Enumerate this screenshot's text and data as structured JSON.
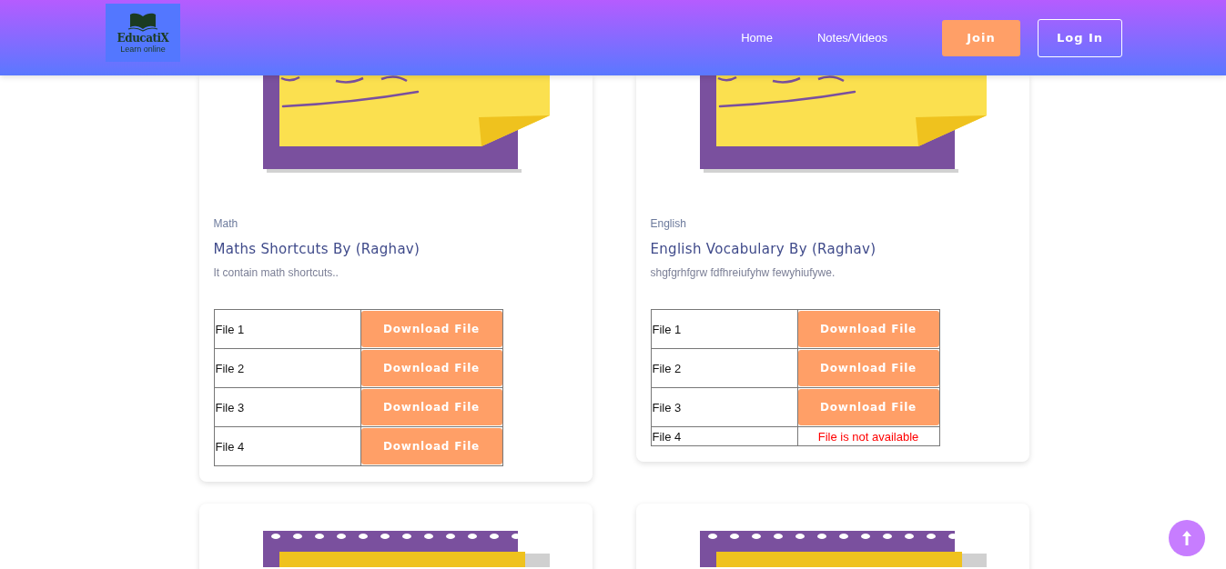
{
  "header": {
    "logo": {
      "name": "EducatiX",
      "tagline": "Learn online"
    },
    "nav": [
      {
        "label": "Home",
        "kind": "link"
      },
      {
        "label": "Notes/Videos",
        "kind": "link"
      },
      {
        "label": "Join",
        "kind": "primary"
      },
      {
        "label": "Log In",
        "kind": "outline"
      }
    ]
  },
  "cards": [
    {
      "kind": "sticky-note",
      "category": "Math",
      "title": "Maths Shortcuts By (Raghav)",
      "description": "It contain math shortcuts..",
      "files": [
        {
          "label": "File 1",
          "kind": "download",
          "action": "Download File"
        },
        {
          "label": "File 2",
          "kind": "download",
          "action": "Download File"
        },
        {
          "label": "File 3",
          "kind": "download",
          "action": "Download File"
        },
        {
          "label": "File 4",
          "kind": "download",
          "action": "Download File"
        }
      ]
    },
    {
      "kind": "sticky-note",
      "category": "English",
      "title": "English Vocabulary By (Raghav)",
      "description": "shgfgrhfgrw fdfhreiufyhw fewyhiufywe.",
      "files": [
        {
          "label": "File 1",
          "kind": "download",
          "action": "Download File"
        },
        {
          "label": "File 2",
          "kind": "download",
          "action": "Download File"
        },
        {
          "label": "File 3",
          "kind": "download",
          "action": "Download File"
        },
        {
          "label": "File 4",
          "kind": "unavailable",
          "action": "File is not available"
        }
      ]
    },
    {
      "kind": "notebook"
    },
    {
      "kind": "notebook"
    }
  ]
}
